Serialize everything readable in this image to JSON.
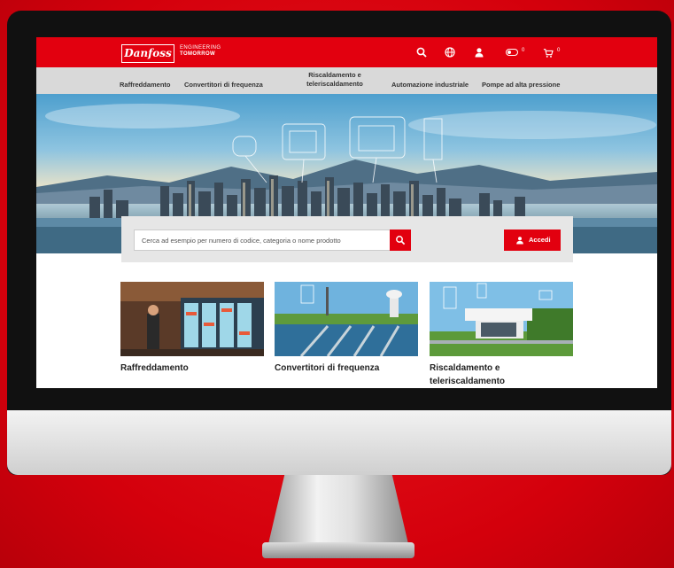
{
  "header": {
    "logo_text": "Danfoss",
    "tagline_1": "ENGINEERING",
    "tagline_2": "TOMORROW",
    "icons": [
      "search-icon",
      "globe-icon",
      "user-icon",
      "toggle-icon",
      "cart-icon"
    ],
    "counts": [
      "0",
      "0"
    ]
  },
  "nav": {
    "items": [
      {
        "label": "Raffreddamento"
      },
      {
        "label": "Convertitori di frequenza"
      },
      {
        "label": "Riscaldamento e teleriscaldamento"
      },
      {
        "label": "Automazione industriale"
      },
      {
        "label": "Pompe ad alta pressione"
      }
    ]
  },
  "search": {
    "placeholder": "Cerca ad esempio per numero di codice, categoria o nome prodotto",
    "login_label": "Accedi"
  },
  "cards": [
    {
      "title": "Raffreddamento"
    },
    {
      "title": "Convertitori di frequenza"
    },
    {
      "title": "Riscaldamento e teleriscaldamento"
    }
  ],
  "colors": {
    "brand_red": "#e2000f",
    "nav_gray": "#d9d9d9",
    "background_red": "#e2000f"
  }
}
